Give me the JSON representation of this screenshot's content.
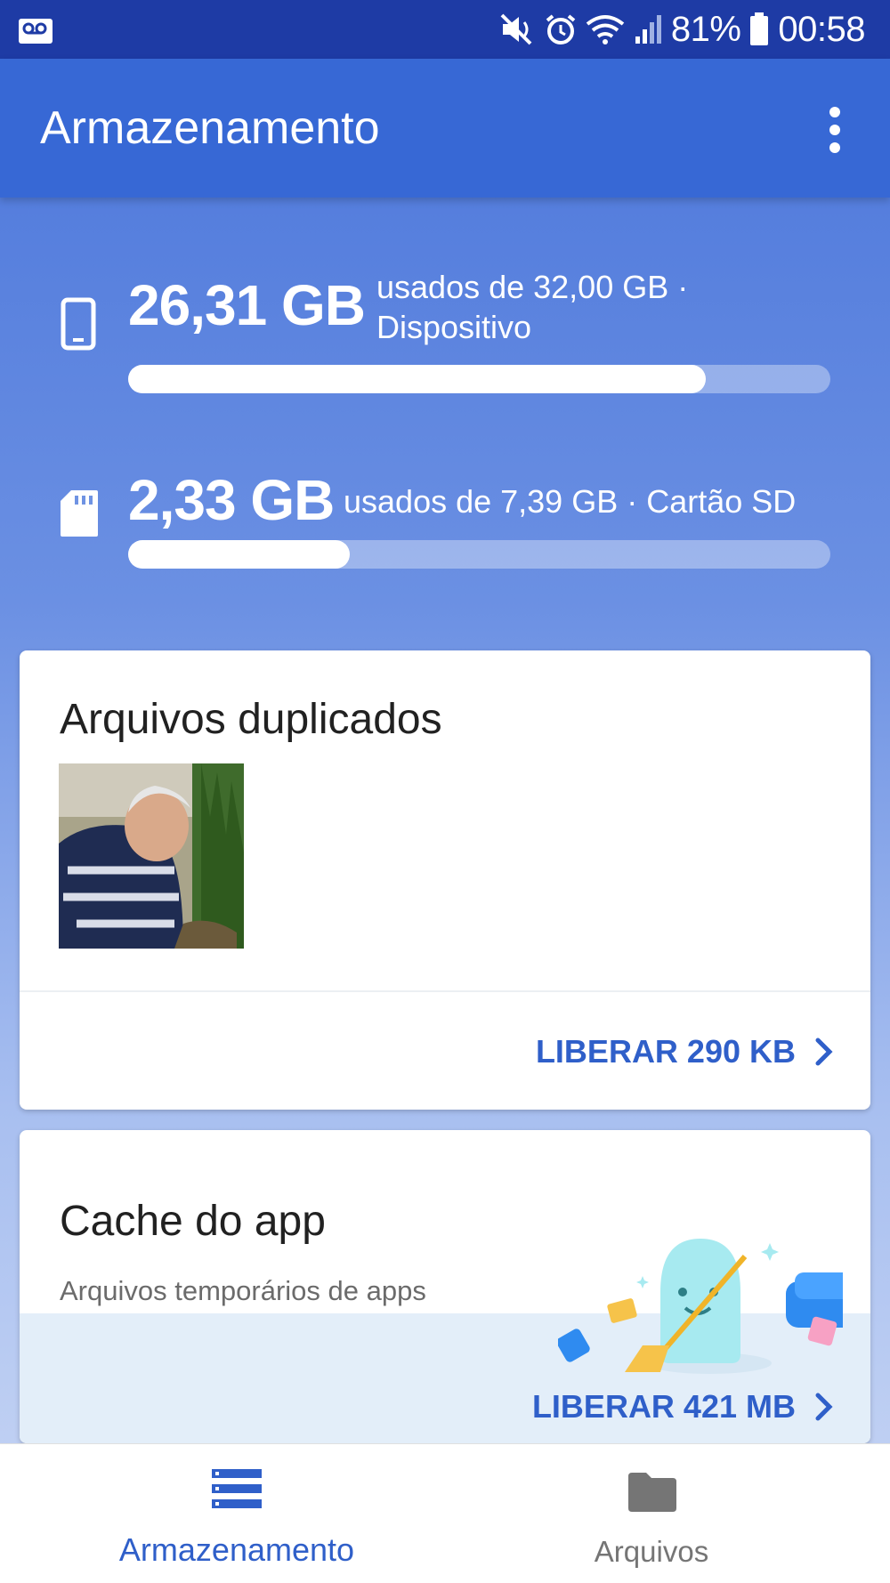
{
  "status_bar": {
    "battery_percent": "81%",
    "time": "00:58",
    "icons": [
      "voicemail-icon",
      "mute-icon",
      "alarm-icon",
      "wifi-icon",
      "signal-icon",
      "battery-icon"
    ]
  },
  "app_bar": {
    "title": "Armazenamento",
    "overflow_icon": "more-vert-icon"
  },
  "storage": {
    "device": {
      "used": "26,31 GB",
      "desc_line1": "usados de 32,00 GB ·",
      "desc_line2": "Dispositivo",
      "fill_fraction": 0.822,
      "icon": "phone-icon"
    },
    "sd_card": {
      "used": "2,33 GB",
      "desc": "usados de 7,39 GB · Cartão SD",
      "fill_fraction": 0.315,
      "icon": "sd-card-icon"
    }
  },
  "cards": {
    "duplicates": {
      "title": "Arquivos duplicados",
      "action": "LIBERAR 290 KB"
    },
    "cache": {
      "title": "Cache do app",
      "subtitle": "Arquivos temporários de apps",
      "action": "LIBERAR 421 MB"
    }
  },
  "bottom_nav": {
    "items": [
      {
        "label": "Armazenamento",
        "icon": "storage-list-icon",
        "active": true
      },
      {
        "label": "Arquivos",
        "icon": "folder-icon",
        "active": false
      }
    ]
  },
  "colors": {
    "primary": "#3768d5",
    "status_bar": "#1e3ba5",
    "action_text": "#2f5fc9",
    "inactive_nav": "#757575"
  }
}
